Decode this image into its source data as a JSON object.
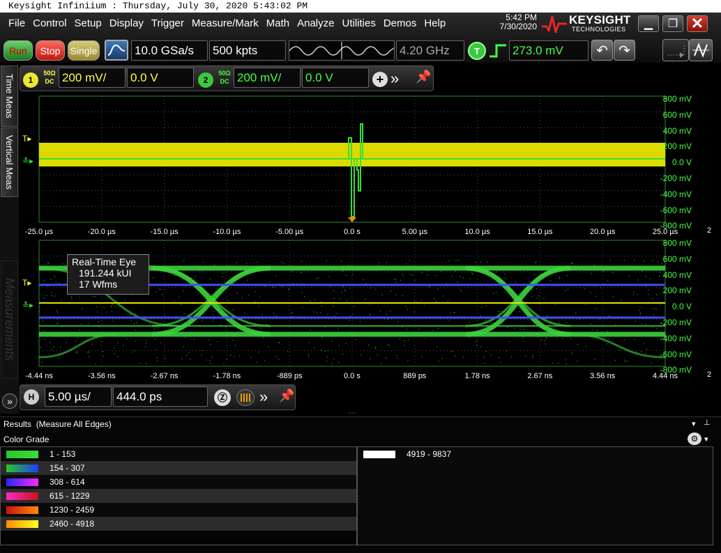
{
  "window_title": "Keysight Infiniium : Thursday, July 30, 2020 5:43:02 PM",
  "menu": [
    "File",
    "Control",
    "Setup",
    "Display",
    "Trigger",
    "Measure/Mark",
    "Math",
    "Analyze",
    "Utilities",
    "Demos",
    "Help"
  ],
  "clock": {
    "time": "5:42 PM",
    "date": "7/30/2020"
  },
  "brand": {
    "name": "KEYSIGHT",
    "sub": "TECHNOLOGIES"
  },
  "toolbar": {
    "run_label": "Run",
    "stop_label": "Stop",
    "single_label": "Single",
    "sample_rate": "10.0 GSa/s",
    "memory_depth": "500 kpts",
    "bandwidth": "4.20 GHz",
    "trigger_badge": "T",
    "trigger_level": "273.0 mV"
  },
  "channels": [
    {
      "number": "1",
      "impedance": "50Ω",
      "coupling": "DC",
      "scale": "200 mV/",
      "offset": "0.0 V"
    },
    {
      "number": "2",
      "impedance": "50Ω",
      "coupling": "DC",
      "scale": "200 mV/",
      "offset": "0.0 V"
    }
  ],
  "sidebar_tabs": [
    "Time Meas",
    "Vertical Meas",
    "Measurements"
  ],
  "grid1": {
    "x_ticks": [
      "-25.0 µs",
      "-20.0 µs",
      "-15.0 µs",
      "-10.0 µs",
      "-5.00 µs",
      "0.0 s",
      "5.00 µs",
      "10.0 µs",
      "15.0 µs",
      "20.0 µs",
      "25.0 µs"
    ],
    "y_ticks": [
      "800 mV",
      "600 mV",
      "400 mV",
      "200 mV",
      "0.0 V",
      "-200 mV",
      "-400 mV",
      "-600 mV",
      "-800 mV"
    ],
    "corner": "2"
  },
  "grid2": {
    "x_ticks": [
      "-4.44 ns",
      "-3.56 ns",
      "-2.67 ns",
      "-1.78 ns",
      "-889 ps",
      "0.0 s",
      "889 ps",
      "1.78 ns",
      "2.67 ns",
      "3.56 ns",
      "4.44 ns"
    ],
    "y_ticks": [
      "800 mV",
      "600 mV",
      "400 mV",
      "200 mV",
      "0.0 V",
      "-200 mV",
      "-400 mV",
      "-600 mV",
      "-800 mV"
    ],
    "corner": "2"
  },
  "eye_label": {
    "title": "Real-Time Eye",
    "ui": "191.244 kUI",
    "wfms": "17 Wfms"
  },
  "horizontal": {
    "badge": "H",
    "scale": "5.00 µs/",
    "position": "444.0 ps"
  },
  "results": {
    "title": "Results",
    "subtitle": "(Measure All Edges)",
    "section": "Color Grade"
  },
  "color_grade": [
    {
      "range": "1 - 153",
      "gradient": [
        "#28c828",
        "#3cdc3c"
      ]
    },
    {
      "range": "154 - 307",
      "gradient": [
        "#28c828",
        "#1a3cff"
      ]
    },
    {
      "range": "308 - 614",
      "gradient": [
        "#2828ff",
        "#ff28ff"
      ]
    },
    {
      "range": "615 - 1229",
      "gradient": [
        "#ff28c8",
        "#c81414"
      ]
    },
    {
      "range": "1230 - 2459",
      "gradient": [
        "#c81414",
        "#ff8c00"
      ]
    },
    {
      "range": "2460 - 4918",
      "gradient": [
        "#ff8c00",
        "#ffff28"
      ]
    }
  ],
  "color_grade_right": {
    "range": "4919 - 9837",
    "color": "#ffffff"
  }
}
